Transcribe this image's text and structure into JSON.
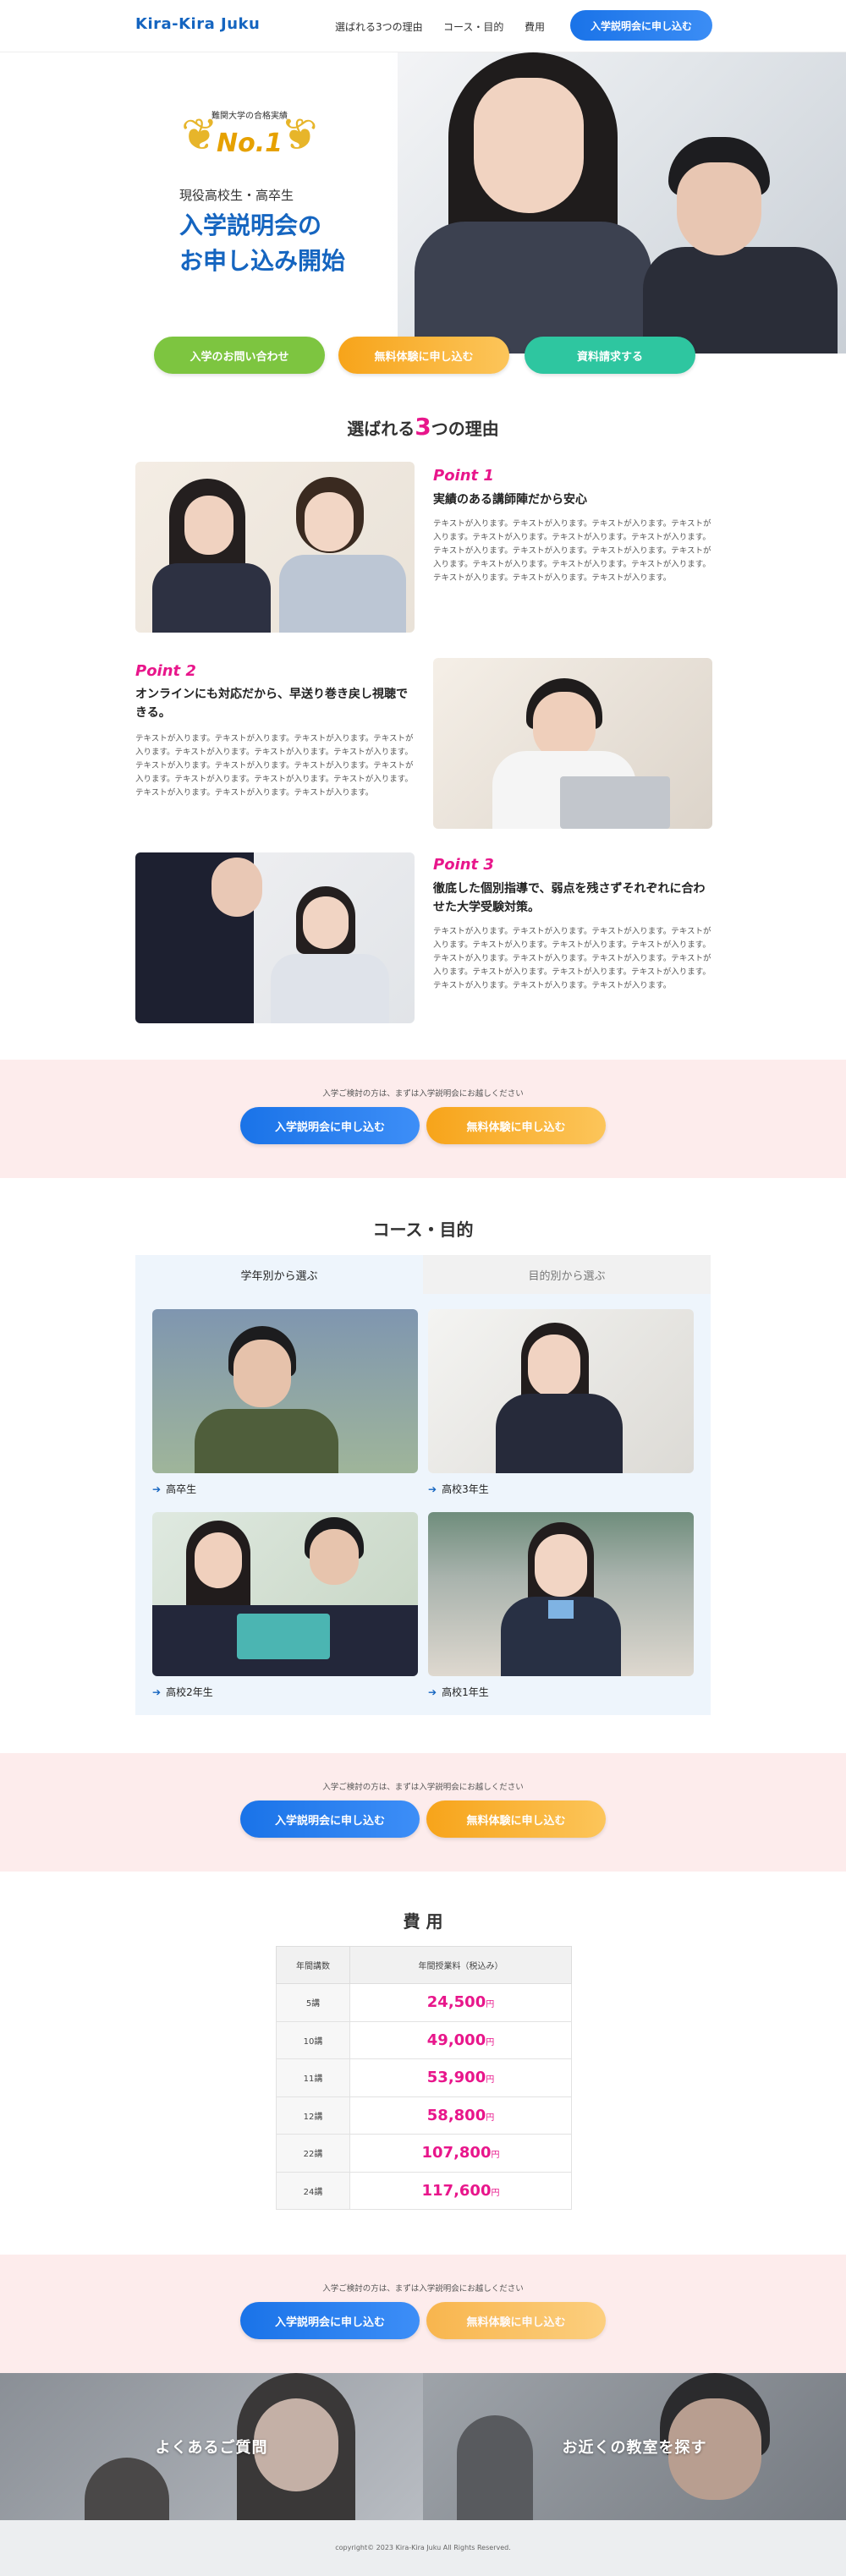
{
  "header": {
    "logo": "Kira-Kira Juku",
    "nav": [
      "選ばれる3つの理由",
      "コース・目的",
      "費用"
    ],
    "cta": "入学説明会に申し込む"
  },
  "hero": {
    "award_sub": "難関大学の合格実績",
    "award_badge": "No.1",
    "lead": "現役高校生・高卒生",
    "title_line1": "入学説明会の",
    "title_line2": "お申し込み開始",
    "buttons": [
      "入学のお問い合わせ",
      "無料体験に申し込む",
      "資料請求する"
    ]
  },
  "reasons": {
    "title_pre": "選ばれる",
    "title_num": "3",
    "title_post": "つの理由",
    "items": [
      {
        "point": "Point 1",
        "heading": "実績のある講師陣だから安心",
        "body": "テキストが入ります。テキストが入ります。テキストが入ります。テキストが入ります。テキストが入ります。テキストが入ります。テキストが入ります。テキストが入ります。テキストが入ります。テキストが入ります。テキストが入ります。テキストが入ります。テキストが入ります。テキストが入ります。テキストが入ります。テキストが入ります。テキストが入ります。"
      },
      {
        "point": "Point 2",
        "heading": "オンラインにも対応だから、早送り巻き戻し視聴できる。",
        "body": "テキストが入ります。テキストが入ります。テキストが入ります。テキストが入ります。テキストが入ります。テキストが入ります。テキストが入ります。テキストが入ります。テキストが入ります。テキストが入ります。テキストが入ります。テキストが入ります。テキストが入ります。テキストが入ります。テキストが入ります。テキストが入ります。テキストが入ります。"
      },
      {
        "point": "Point 3",
        "heading": "徹底した個別指導で、弱点を残さずそれぞれに合わせた大学受験対策。",
        "body": "テキストが入ります。テキストが入ります。テキストが入ります。テキストが入ります。テキストが入ります。テキストが入ります。テキストが入ります。テキストが入ります。テキストが入ります。テキストが入ります。テキストが入ります。テキストが入ります。テキストが入ります。テキストが入ります。テキストが入ります。テキストが入ります。テキストが入ります。"
      }
    ]
  },
  "cta_band": {
    "note": "入学ご検討の方は、まずは入学説明会にお越しください",
    "primary": "入学説明会に申し込む",
    "secondary": "無料体験に申し込む"
  },
  "courses": {
    "title": "コース・目的",
    "tabs": [
      "学年別から選ぶ",
      "目的別から選ぶ"
    ],
    "items": [
      "高卒生",
      "高校3年生",
      "高校2年生",
      "高校1年生"
    ]
  },
  "fees": {
    "title": "費 用",
    "headers": [
      "年間講数",
      "年間授業料（税込み）"
    ],
    "rows": [
      {
        "count": "5講",
        "price": "24,500",
        "unit": "円"
      },
      {
        "count": "10講",
        "price": "49,000",
        "unit": "円"
      },
      {
        "count": "11講",
        "price": "53,900",
        "unit": "円"
      },
      {
        "count": "12講",
        "price": "58,800",
        "unit": "円"
      },
      {
        "count": "22講",
        "price": "107,800",
        "unit": "円"
      },
      {
        "count": "24講",
        "price": "117,600",
        "unit": "円"
      }
    ]
  },
  "bottom_links": [
    "よくあるご質問",
    "お近くの教室を探す"
  ],
  "footer": "copyright© 2023 Kira-Kira Juku All Rights Reserved.",
  "colors": {
    "brand_blue": "#1565c0",
    "accent_pink": "#e8168b",
    "band_pink": "#fdecec",
    "button_orange": "#f7a41a",
    "button_green": "#7dc540",
    "button_teal": "#2ec6a0"
  }
}
